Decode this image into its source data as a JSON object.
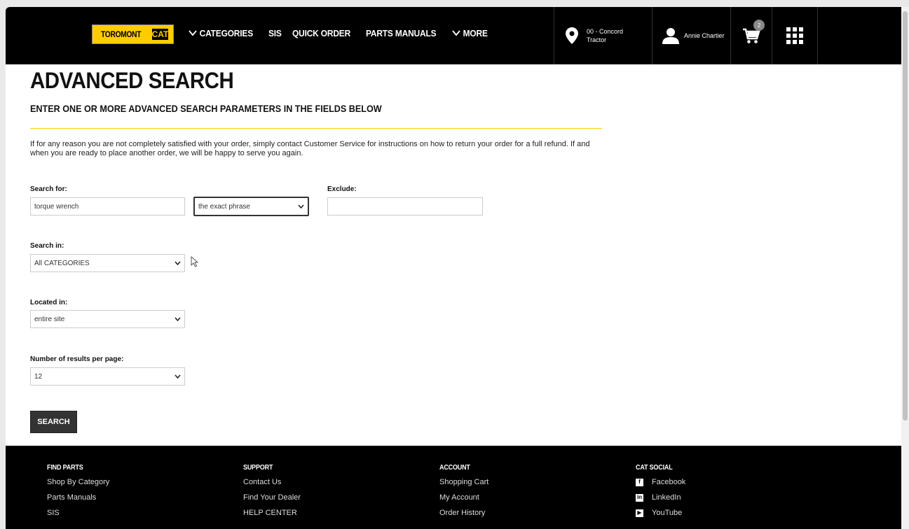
{
  "header": {
    "logo": {
      "toromont": "TOROMONT",
      "cat": "CAT"
    },
    "nav": [
      {
        "label": "CATEGORIES",
        "has_chevron": true
      },
      {
        "label": "SIS",
        "has_chevron": false
      },
      {
        "label": "QUICK ORDER",
        "has_chevron": false
      },
      {
        "label": "PARTS MANUALS",
        "has_chevron": false
      },
      {
        "label": "MORE",
        "has_chevron": true
      }
    ],
    "location": {
      "line1": "00 - Concord",
      "line2": "Tractor",
      "icon": "map-pin-icon"
    },
    "user": {
      "name": "Annie Chartier",
      "icon": "user-icon"
    },
    "cart": {
      "count": "2",
      "icon": "cart-icon"
    },
    "apps_icon": "grid-icon"
  },
  "page": {
    "title": "ADVANCED SEARCH",
    "subtitle": "ENTER ONE OR MORE ADVANCED SEARCH PARAMETERS IN THE FIELDS BELOW",
    "intro": "If for any reason you are not completely satisfied with your order, simply contact Customer Service for instructions on how to return your order for a full refund. If and when you are ready to place another order, we will be happy to serve you again."
  },
  "form": {
    "search_for_label": "Search for:",
    "search_for_value": "torque wrench",
    "match_mode_value": "the exact phrase",
    "exclude_label": "Exclude:",
    "exclude_value": "",
    "search_in_label": "Search in:",
    "search_in_value": "All CATEGORIES",
    "located_in_label": "Located in:",
    "located_in_value": "entire site",
    "results_label": "Number of results per page:",
    "results_value": "12",
    "submit_label": "SEARCH"
  },
  "footer": {
    "columns": [
      {
        "heading": "FIND PARTS",
        "links": [
          "Shop By Category",
          "Parts Manuals",
          "SIS"
        ]
      },
      {
        "heading": "SUPPORT",
        "links": [
          "Contact Us",
          "Find Your Dealer",
          "HELP CENTER"
        ]
      },
      {
        "heading": "ACCOUNT",
        "links": [
          "Shopping Cart",
          "My Account",
          "Order History"
        ]
      },
      {
        "heading": "CAT SOCIAL",
        "links": [
          "Facebook",
          "LinkedIn",
          "YouTube"
        ]
      }
    ]
  }
}
